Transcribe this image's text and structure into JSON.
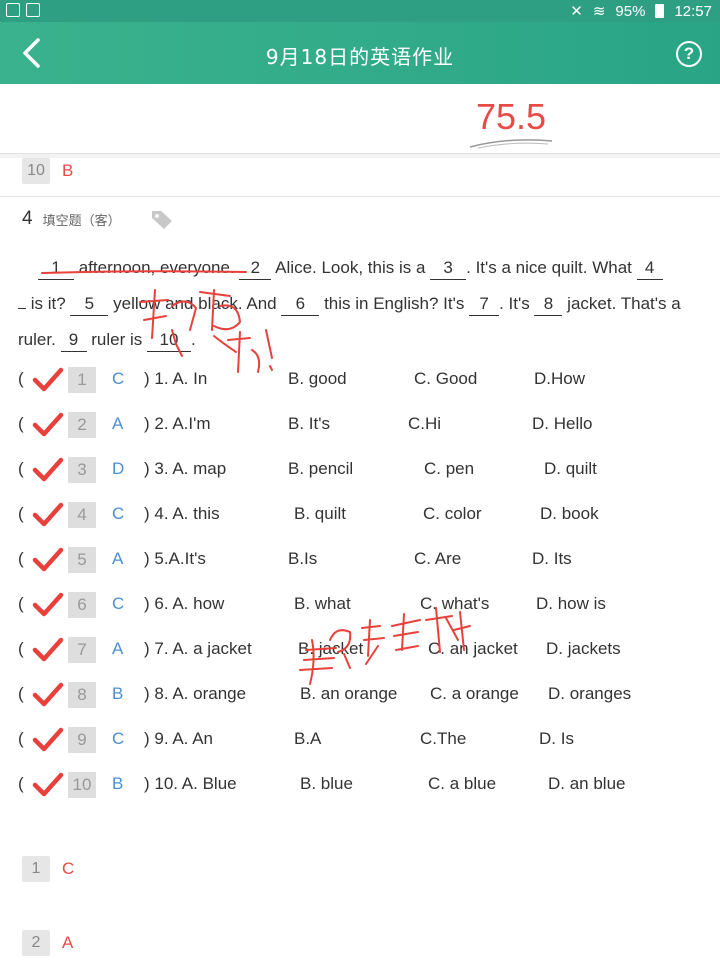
{
  "status": {
    "battery": "95%",
    "time": "12:57"
  },
  "header": {
    "title": "9月18日的英语作业",
    "help": "?"
  },
  "score": "75.5",
  "top_answer": {
    "num": "10",
    "letter": "B"
  },
  "question": {
    "number": "4",
    "type": "填空题（客）"
  },
  "passage": {
    "line1": {
      "b1": "1",
      "t1": " afternoon, everyone. ",
      "b2": "2",
      "t2": " Alice. Look, this is a ",
      "b3": "3",
      "t3": ". It's a nice quilt. What ",
      "b4": "4"
    },
    "line2": {
      "t1": " is it? ",
      "b5": "5",
      "t2": " yellow and black. And ",
      "b6": "6",
      "t3": " this in English? It's ",
      "b7": "7",
      "t4": ". It's ",
      "b8": "8",
      "t5": " jacket. That's a"
    },
    "line3": {
      "t1": "ruler. ",
      "b9": "9",
      "t2": " ruler is ",
      "b10": "10",
      "t3": "."
    }
  },
  "options": [
    {
      "num": "1",
      "ans": "C",
      "q": ") 1. A. In",
      "b": "B. good",
      "c": "C. Good",
      "d": "D.How"
    },
    {
      "num": "2",
      "ans": "A",
      "q": ") 2. A.I'm",
      "b": "B. It's",
      "c": "C.Hi",
      "d": "D. Hello"
    },
    {
      "num": "3",
      "ans": "D",
      "q": ") 3. A. map",
      "b": "B. pencil",
      "c": "C. pen",
      "d": "D. quilt"
    },
    {
      "num": "4",
      "ans": "C",
      "q": ") 4. A. this",
      "b": "B. quilt",
      "c": "C. color",
      "d": "D. book"
    },
    {
      "num": "5",
      "ans": "A",
      "q": ") 5.A.It's",
      "b": "B.Is",
      "c": "C. Are",
      "d": "D. Its"
    },
    {
      "num": "6",
      "ans": "C",
      "q": ") 6. A. how",
      "b": "B. what",
      "c": "C. what's",
      "d": "D. how is"
    },
    {
      "num": "7",
      "ans": "A",
      "q": ") 7. A. a jacket",
      "b": "B. jacket",
      "c": "C. an jacket",
      "d": "D. jackets"
    },
    {
      "num": "8",
      "ans": "B",
      "q": ") 8. A. orange",
      "b": "B. an orange",
      "c": "C. a orange",
      "d": "D. oranges"
    },
    {
      "num": "9",
      "ans": "C",
      "q": ") 9. A. An",
      "b": "B.A",
      "c": "C.The",
      "d": "D. Is"
    },
    {
      "num": "10",
      "ans": "B",
      "q": ") 10. A. Blue",
      "b": "B. blue",
      "c": "C. a blue",
      "d": "D. an blue"
    }
  ],
  "bottom_answers": [
    {
      "num": "1",
      "letter": "C"
    },
    {
      "num": "2",
      "letter": "A"
    }
  ],
  "colors": {
    "accent": "#2fa987",
    "wrong": "#e84b47",
    "correct_answer": "#4a8fd6"
  }
}
